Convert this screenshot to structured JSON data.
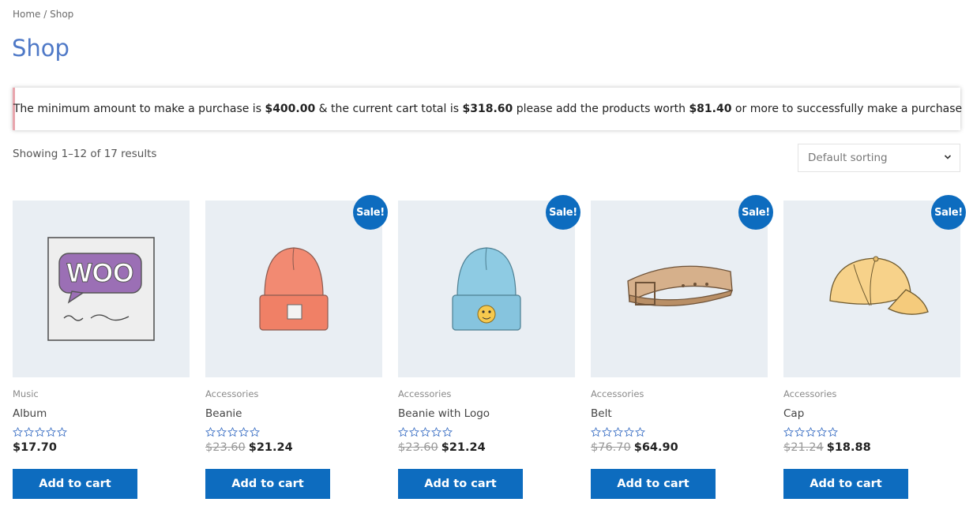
{
  "breadcrumb": {
    "home": "Home",
    "separator": " / ",
    "current": "Shop"
  },
  "page_title": "Shop",
  "notice": {
    "part1": "The minimum amount to make a purchase is ",
    "min_amount": "$400.00",
    "part2": " & the current cart total is ",
    "cart_total": "$318.60",
    "part3": " please add the products worth ",
    "remaining": "$81.40",
    "part4": " or more to successfully make a purchase"
  },
  "result_count": "Showing 1–12 of 17 results",
  "ordering": {
    "selected": "Default sorting"
  },
  "colors": {
    "accent": "#0d6cbf",
    "title": "#4f79c7",
    "notice_border": "#e8a5ad"
  },
  "products": [
    {
      "category": "Music",
      "name": "Album",
      "price_old": "",
      "price": "$17.70",
      "sale": "",
      "button": "Add to cart",
      "rating": 0,
      "image": "album-icon"
    },
    {
      "category": "Accessories",
      "name": "Beanie",
      "price_old": "$23.60",
      "price": "$21.24",
      "sale": "Sale!",
      "button": "Add to cart",
      "rating": 0,
      "image": "beanie-icon"
    },
    {
      "category": "Accessories",
      "name": "Beanie with Logo",
      "price_old": "$23.60",
      "price": "$21.24",
      "sale": "Sale!",
      "button": "Add to cart",
      "rating": 0,
      "image": "beanie-logo-icon"
    },
    {
      "category": "Accessories",
      "name": "Belt",
      "price_old": "$76.70",
      "price": "$64.90",
      "sale": "Sale!",
      "button": "Add to cart",
      "rating": 0,
      "image": "belt-icon"
    },
    {
      "category": "Accessories",
      "name": "Cap",
      "price_old": "$21.24",
      "price": "$18.88",
      "sale": "Sale!",
      "button": "Add to cart",
      "rating": 0,
      "image": "cap-icon"
    }
  ]
}
